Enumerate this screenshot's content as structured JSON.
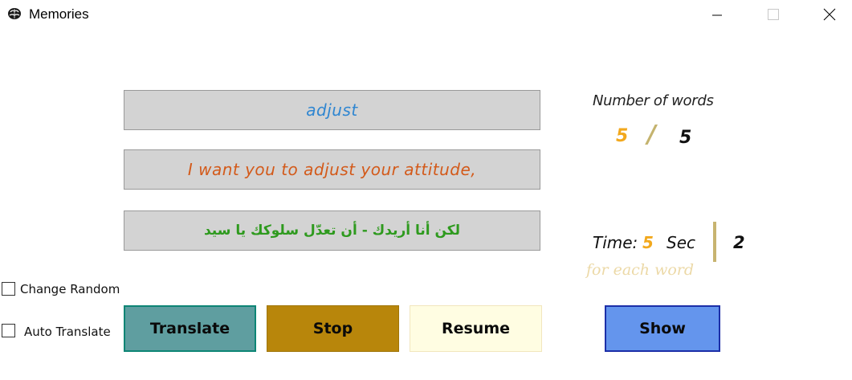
{
  "window": {
    "title": "Memories",
    "icon": "brain-icon"
  },
  "word_box": {
    "text": "adjust"
  },
  "sentence_box": {
    "text": "I want you to adjust your attitude,"
  },
  "arabic_box": {
    "text": "لكن أنا أريدك - أن تعدّل سلوكك يا سيد"
  },
  "word_count": {
    "label": "Number of words",
    "current": "5",
    "separator": "/",
    "total": "5"
  },
  "timer": {
    "label": "Time:",
    "value": "5",
    "unit": "Sec",
    "countdown": "2",
    "note": "for each word"
  },
  "options": {
    "change_random": "Change Random",
    "auto_translate": "Auto Translate"
  },
  "buttons": {
    "translate": "Translate",
    "stop": "Stop",
    "resume": "Resume",
    "show": "Show"
  },
  "colors": {
    "word": "#2f86d1",
    "sentence": "#d35a1a",
    "arabic": "#2e9a1e",
    "accent_number": "#f2a81d",
    "translate_bg": "#5f9ea0",
    "stop_bg": "#b8860b",
    "resume_bg": "#fffde2",
    "show_bg": "#6495ed"
  }
}
